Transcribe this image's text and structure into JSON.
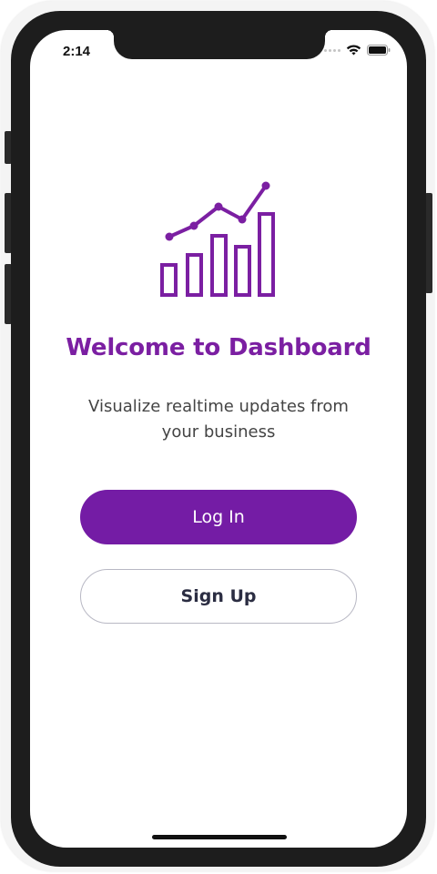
{
  "status_bar": {
    "time": "2:14",
    "wifi_icon": "wifi-icon",
    "battery_icon": "battery-icon"
  },
  "hero": {
    "icon": "bar-line-chart-icon",
    "accent_color": "#7b1fa2"
  },
  "welcome": {
    "title": "Welcome to Dashboard",
    "subtitle": "Visualize realtime updates from your business"
  },
  "actions": {
    "login_label": "Log In",
    "signup_label": "Sign Up",
    "primary_color": "#741ca5"
  }
}
